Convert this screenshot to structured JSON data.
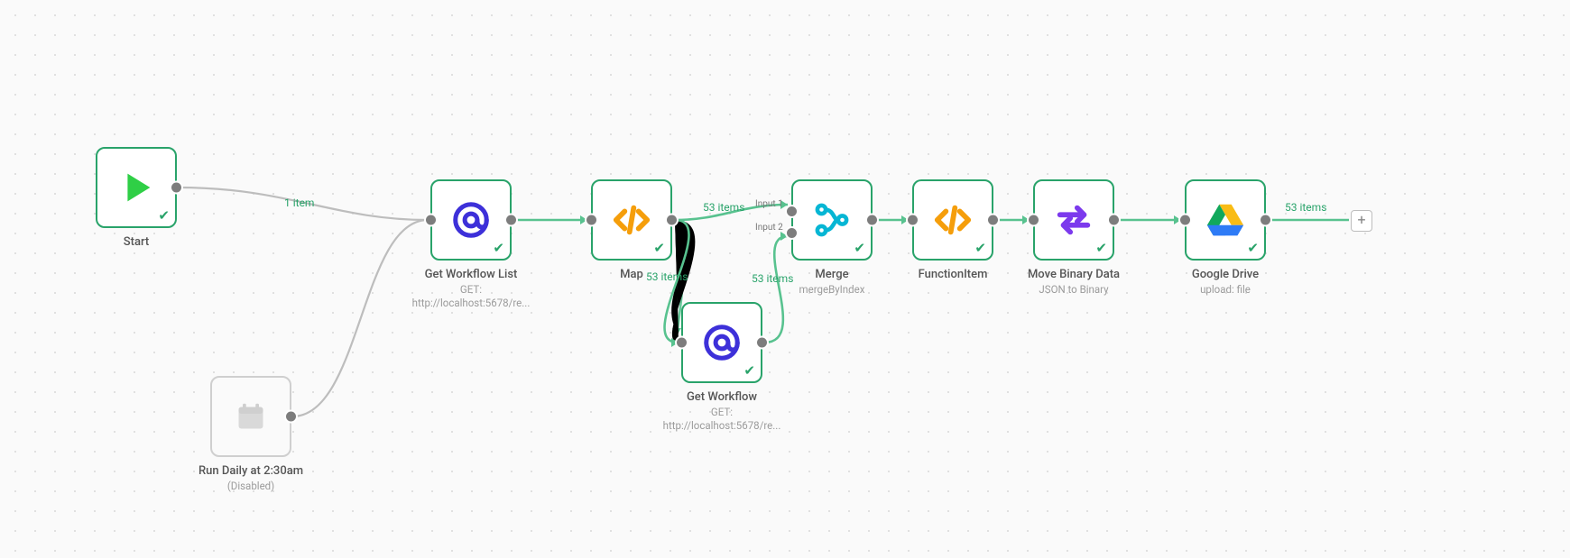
{
  "nodes": {
    "start": {
      "title": "Start"
    },
    "cron": {
      "title": "Run Daily at 2:30am",
      "sub1": "(Disabled)"
    },
    "getList": {
      "title": "Get Workflow List",
      "sub1": "GET: http://localhost:5678/re..."
    },
    "map": {
      "title": "Map"
    },
    "getWorkflow": {
      "title": "Get Workflow",
      "sub1": "GET: http://localhost:5678/re..."
    },
    "merge": {
      "title": "Merge",
      "sub1": "mergeByIndex",
      "in1": "Input 1",
      "in2": "Input 2"
    },
    "functionItem": {
      "title": "FunctionItem"
    },
    "moveBinary": {
      "title": "Move Binary Data",
      "sub1": "JSON to Binary"
    },
    "gdrive": {
      "title": "Google Drive",
      "sub1": "upload: file"
    }
  },
  "edgeLabels": {
    "start_out": "1 item",
    "map_out_top": "53 items",
    "map_out_bottom": "53 items",
    "getWorkflow_out": "53 items",
    "gdrive_out": "53 items"
  },
  "addButton": "+"
}
